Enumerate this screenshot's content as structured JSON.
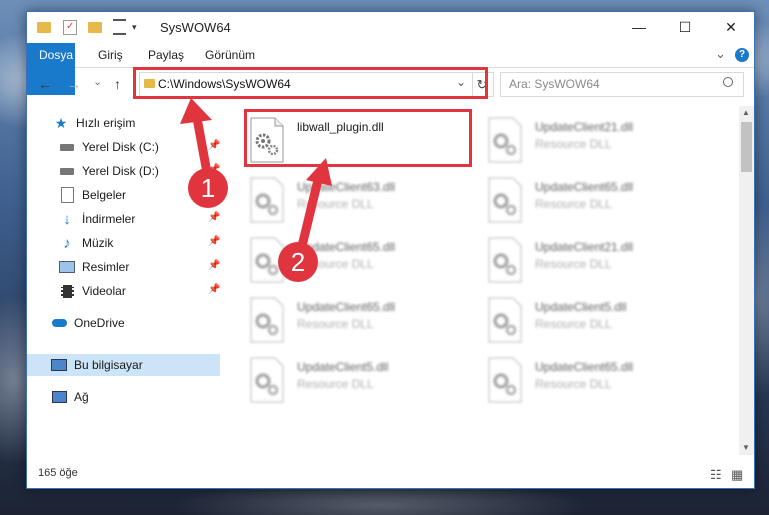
{
  "window": {
    "title": "SysWOW64",
    "controls": {
      "minimize": "—",
      "maximize": "☐",
      "close": "✕"
    }
  },
  "ribbon": {
    "tabs": [
      "Dosya",
      "Giriş",
      "Paylaş",
      "Görünüm"
    ],
    "collapse_glyph": "⌄",
    "help_glyph": "?"
  },
  "navigation": {
    "back": "←",
    "forward": "→",
    "recent": "⌄",
    "up": "↑",
    "address": "C:\\Windows\\SysWOW64",
    "address_dropdown": "⌄",
    "refresh": "↻",
    "search_placeholder": "Ara: SysWOW64"
  },
  "sidebar": {
    "items": [
      {
        "label": "Hızlı erişim",
        "icon": "star-icon"
      },
      {
        "label": "Yerel Disk (C:)",
        "icon": "drive-icon",
        "pinned": true
      },
      {
        "label": "Yerel Disk (D:)",
        "icon": "drive-icon",
        "pinned": true
      },
      {
        "label": "Belgeler",
        "icon": "documents-icon",
        "pinned": true
      },
      {
        "label": "İndirmeler",
        "icon": "downloads-icon",
        "pinned": true
      },
      {
        "label": "Müzik",
        "icon": "music-icon",
        "pinned": true
      },
      {
        "label": "Resimler",
        "icon": "pictures-icon",
        "pinned": true
      },
      {
        "label": "Videolar",
        "icon": "videos-icon",
        "pinned": true
      },
      {
        "label": "OneDrive",
        "icon": "cloud-icon"
      },
      {
        "label": "Bu bilgisayar",
        "icon": "computer-icon",
        "selected": true
      },
      {
        "label": "Ağ",
        "icon": "network-icon"
      }
    ],
    "pin_glyph": "📌"
  },
  "files": [
    {
      "name": "libwall_plugin.dll",
      "type": ""
    },
    {
      "name": "UpdateClient21.dll",
      "type": "Resource DLL"
    },
    {
      "name": "UpdateClient63.dll",
      "type": "Resource DLL"
    },
    {
      "name": "UpdateClient65.dll",
      "type": "Resource DLL"
    },
    {
      "name": "UpdateClient65.dll",
      "type": "Resource DLL"
    },
    {
      "name": "UpdateClient21.dll",
      "type": "Resource DLL"
    },
    {
      "name": "UpdateClient65.dll",
      "type": "Resource DLL"
    },
    {
      "name": "UpdateClient5.dll",
      "type": "Resource DLL"
    },
    {
      "name": "UpdateClient5.dll",
      "type": "Resource DLL"
    },
    {
      "name": "UpdateClient65.dll",
      "type": "Resource DLL"
    }
  ],
  "status": {
    "count": "165 öğe"
  },
  "annotations": {
    "step1": "1",
    "step2": "2",
    "color": "#e0343e"
  },
  "colors": {
    "accent": "#1979ca",
    "selection": "#cce4f7",
    "highlight": "#e0343e"
  }
}
